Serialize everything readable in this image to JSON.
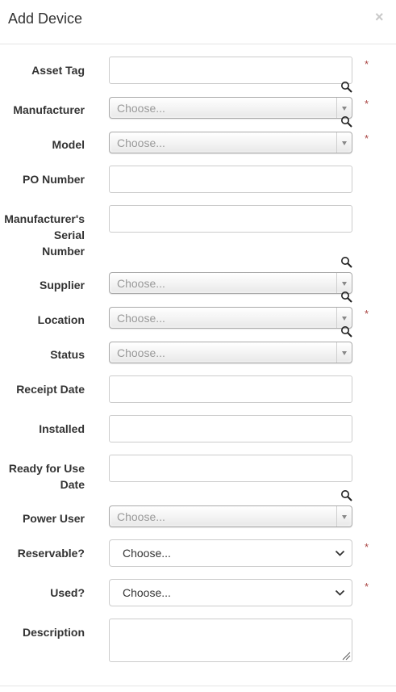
{
  "dialog": {
    "title": "Add Device",
    "close_glyph": "×"
  },
  "required_marker": "*",
  "placeholder": "Choose...",
  "fields": {
    "asset_tag": {
      "label": "Asset Tag",
      "value": ""
    },
    "manufacturer": {
      "label": "Manufacturer",
      "value": "Choose..."
    },
    "model": {
      "label": "Model",
      "value": "Choose..."
    },
    "po_number": {
      "label": "PO Number",
      "value": ""
    },
    "serial": {
      "label_line1": "Manufacturer's",
      "label_line2": "Serial",
      "label_line3": "Number",
      "value": ""
    },
    "supplier": {
      "label": "Supplier",
      "value": "Choose..."
    },
    "location": {
      "label": "Location",
      "value": "Choose..."
    },
    "status": {
      "label": "Status",
      "value": "Choose..."
    },
    "receipt_date": {
      "label": "Receipt Date",
      "value": ""
    },
    "installed": {
      "label": "Installed",
      "value": ""
    },
    "ready_for_use": {
      "label_line1": "Ready for Use",
      "label_line2": "Date",
      "value": ""
    },
    "power_user": {
      "label": "Power User",
      "value": "Choose..."
    },
    "reservable": {
      "label": "Reservable?",
      "value": "Choose..."
    },
    "used": {
      "label": "Used?",
      "value": "Choose..."
    },
    "description": {
      "label": "Description",
      "value": ""
    }
  },
  "icons": {
    "lookup": "magnifier-icon",
    "dropdown": "chevron-down-icon",
    "resize": "resize-handle-icon"
  },
  "colors": {
    "required": "#a94442",
    "placeholder": "#999999",
    "border": "#cccccc"
  }
}
